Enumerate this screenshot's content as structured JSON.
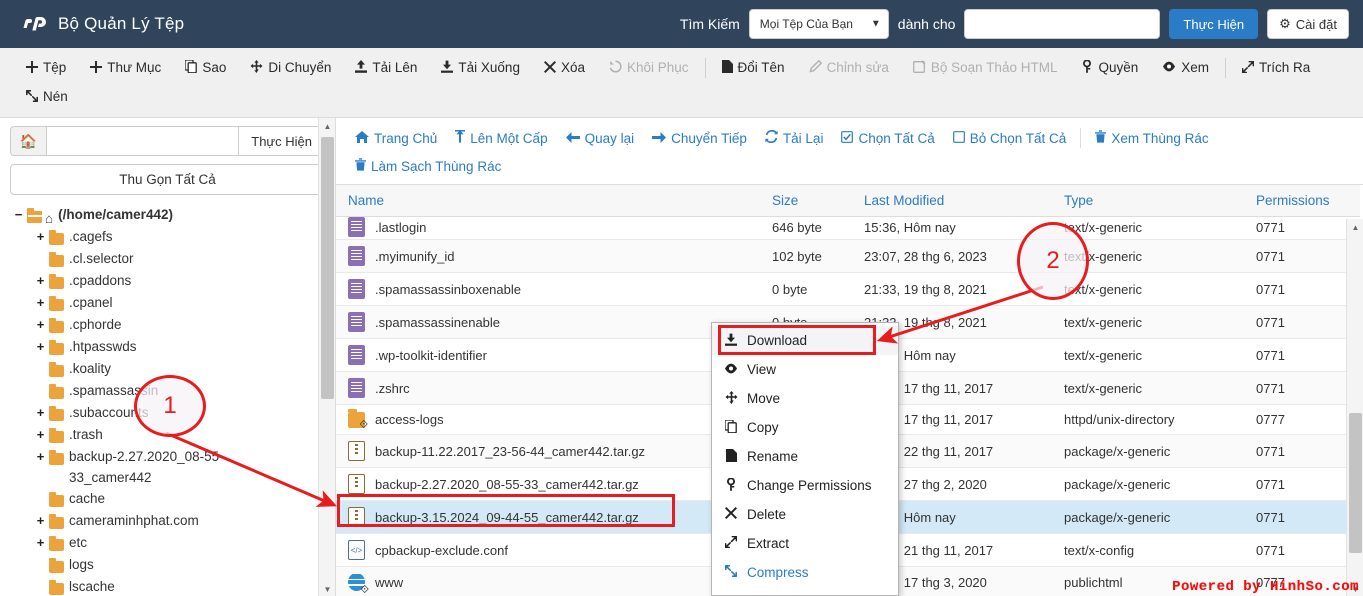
{
  "topbar": {
    "logo": "cp-logo-icon",
    "title": "Bộ Quản Lý Tệp",
    "search_label": "Tìm Kiếm",
    "search_scope_selected": "Mọi Tệp Của Bạn",
    "for_label": "dành cho",
    "search_value": "",
    "search_placeholder": "",
    "go_label": "Thực Hiện",
    "settings_label": "Cài đặt",
    "accent": "#2a7cc7",
    "background": "#30455c"
  },
  "toolbar": {
    "items": [
      {
        "label": "Tệp",
        "icon": "plus-icon",
        "disabled": false,
        "sep_after": false
      },
      {
        "label": "Thư Mục",
        "icon": "plus-icon",
        "disabled": false,
        "sep_after": false
      },
      {
        "label": "Sao",
        "icon": "copy-icon",
        "disabled": false,
        "sep_after": false
      },
      {
        "label": "Di Chuyển",
        "icon": "move-icon",
        "disabled": false,
        "sep_after": false
      },
      {
        "label": "Tải Lên",
        "icon": "upload-icon",
        "disabled": false,
        "sep_after": false
      },
      {
        "label": "Tải Xuống",
        "icon": "download-icon",
        "disabled": false,
        "sep_after": false
      },
      {
        "label": "Xóa",
        "icon": "x-icon",
        "disabled": false,
        "sep_after": false
      },
      {
        "label": "Khôi Phục",
        "icon": "restore-icon",
        "disabled": true,
        "sep_after": true
      },
      {
        "label": "Đổi Tên",
        "icon": "file-icon",
        "disabled": false,
        "sep_after": false
      },
      {
        "label": "Chỉnh sửa",
        "icon": "pencil-icon",
        "disabled": true,
        "sep_after": false
      },
      {
        "label": "Bộ Soạn Thảo HTML",
        "icon": "html-editor-icon",
        "disabled": true,
        "sep_after": false
      },
      {
        "label": "Quyền",
        "icon": "key-icon",
        "disabled": false,
        "sep_after": false
      },
      {
        "label": "Xem",
        "icon": "eye-icon",
        "disabled": false,
        "sep_after": true
      },
      {
        "label": "Trích Ra",
        "icon": "extract-icon",
        "disabled": false,
        "sep_after": false
      },
      {
        "label": "Nén",
        "icon": "compress-icon",
        "disabled": false,
        "sep_after": false
      }
    ]
  },
  "sidebar": {
    "home_icon": "home-icon",
    "path_value": "",
    "go_label": "Thực Hiện",
    "collapse_all_label": "Thu Gọn Tất Cả",
    "tree": [
      {
        "label": "(/home/camer442)",
        "toggle": "−",
        "level": 0,
        "root": true,
        "icon": "home-folder-open-icon"
      },
      {
        "label": ".cagefs",
        "toggle": "+",
        "level": 1,
        "root": false,
        "icon": "folder-icon"
      },
      {
        "label": ".cl.selector",
        "toggle": "",
        "level": 1,
        "root": false,
        "icon": "folder-icon"
      },
      {
        "label": ".cpaddons",
        "toggle": "+",
        "level": 1,
        "root": false,
        "icon": "folder-icon"
      },
      {
        "label": ".cpanel",
        "toggle": "+",
        "level": 1,
        "root": false,
        "icon": "folder-icon"
      },
      {
        "label": ".cphorde",
        "toggle": "+",
        "level": 1,
        "root": false,
        "icon": "folder-icon"
      },
      {
        "label": ".htpasswds",
        "toggle": "+",
        "level": 1,
        "root": false,
        "icon": "folder-icon"
      },
      {
        "label": ".koality",
        "toggle": "",
        "level": 1,
        "root": false,
        "icon": "folder-icon"
      },
      {
        "label": ".spamassassin",
        "toggle": "",
        "level": 1,
        "root": false,
        "icon": "folder-icon"
      },
      {
        "label": ".subaccounts",
        "toggle": "+",
        "level": 1,
        "root": false,
        "icon": "folder-icon"
      },
      {
        "label": ".trash",
        "toggle": "+",
        "level": 1,
        "root": false,
        "icon": "folder-icon"
      },
      {
        "label": "backup-2.27.2020_08-55-33_camer442",
        "toggle": "+",
        "level": 1,
        "root": false,
        "icon": "folder-icon",
        "wrapped": true
      },
      {
        "label": "cache",
        "toggle": "",
        "level": 1,
        "root": false,
        "icon": "folder-icon"
      },
      {
        "label": "cameraminhphat.com",
        "toggle": "+",
        "level": 1,
        "root": false,
        "icon": "folder-icon"
      },
      {
        "label": "etc",
        "toggle": "+",
        "level": 1,
        "root": false,
        "icon": "folder-icon"
      },
      {
        "label": "logs",
        "toggle": "",
        "level": 1,
        "root": false,
        "icon": "folder-icon"
      },
      {
        "label": "lscache",
        "toggle": "",
        "level": 1,
        "root": false,
        "icon": "folder-icon"
      }
    ]
  },
  "content_nav": {
    "items": [
      {
        "label": "Trang Chủ",
        "icon": "home-icon",
        "sep_after": false
      },
      {
        "label": "Lên Một Cấp",
        "icon": "up-icon",
        "sep_after": false
      },
      {
        "label": "Quay lại",
        "icon": "back-arrow-icon",
        "sep_after": false
      },
      {
        "label": "Chuyển Tiếp",
        "icon": "forward-arrow-icon",
        "sep_after": false
      },
      {
        "label": "Tải Lại",
        "icon": "reload-icon",
        "sep_after": false
      },
      {
        "label": "Chọn Tất Cả",
        "icon": "checkbox-checked-icon",
        "sep_after": false
      },
      {
        "label": "Bỏ Chọn Tất Cả",
        "icon": "checkbox-empty-icon",
        "sep_after": true
      },
      {
        "label": "Xem Thùng Rác",
        "icon": "trash-icon",
        "sep_after": false
      },
      {
        "label": "Làm Sạch Thùng Rác",
        "icon": "trash-icon",
        "sep_after": false
      }
    ]
  },
  "table": {
    "columns": [
      "Name",
      "Size",
      "Last Modified",
      "Type",
      "Permissions"
    ],
    "rows": [
      {
        "name": ".lastlogin",
        "size": "646 byte",
        "modified": "15:36, Hôm nay",
        "type": "text/x-generic",
        "perm": "0771",
        "icon": "text-file-icon",
        "partial": true,
        "selected": false
      },
      {
        "name": ".myimunify_id",
        "size": "102 byte",
        "modified": "23:07, 28 thg 6, 2023",
        "type": "text/x-generic",
        "perm": "0771",
        "icon": "text-file-icon",
        "partial": false,
        "selected": false
      },
      {
        "name": ".spamassassinboxenable",
        "size": "0 byte",
        "modified": "21:33, 19 thg 8, 2021",
        "type": "text/x-generic",
        "perm": "0771",
        "icon": "text-file-icon",
        "partial": false,
        "selected": false
      },
      {
        "name": ".spamassassinenable",
        "size": "0 byte",
        "modified": "21:33, 19 thg 8, 2021",
        "type": "text/x-generic",
        "perm": "0771",
        "icon": "text-file-icon",
        "partial": false,
        "selected": false
      },
      {
        "name": ".wp-toolkit-identifier",
        "size": "",
        "modified": "13:03, Hôm nay",
        "type": "text/x-generic",
        "perm": "0771",
        "icon": "text-file-icon",
        "partial": false,
        "selected": false
      },
      {
        "name": ".zshrc",
        "size": "",
        "modified": "07:57, 17 thg 11, 2017",
        "type": "text/x-generic",
        "perm": "0771",
        "icon": "text-file-icon",
        "partial": false,
        "selected": false
      },
      {
        "name": "access-logs",
        "size": "",
        "modified": "07:50, 17 thg 11, 2017",
        "type": "httpd/unix-directory",
        "perm": "0777",
        "icon": "folder-link-icon",
        "partial": false,
        "selected": false
      },
      {
        "name": "backup-11.22.2017_23-56-44_camer442.tar.gz",
        "size": "",
        "modified": "23:58, 22 thg 11, 2017",
        "type": "package/x-generic",
        "perm": "0771",
        "icon": "archive-icon",
        "partial": false,
        "selected": false
      },
      {
        "name": "backup-2.27.2020_08-55-33_camer442.tar.gz",
        "size": "",
        "modified": "08:57, 27 thg 2, 2020",
        "type": "package/x-generic",
        "perm": "0771",
        "icon": "archive-icon",
        "partial": false,
        "selected": false
      },
      {
        "name": "backup-3.15.2024_09-44-55_camer442.tar.gz",
        "size": "",
        "modified": "09:45, Hôm nay",
        "type": "package/x-generic",
        "perm": "0771",
        "icon": "archive-icon",
        "partial": false,
        "selected": true
      },
      {
        "name": "cpbackup-exclude.conf",
        "size": "",
        "modified": "08:02, 21 thg 11, 2017",
        "type": "text/x-config",
        "perm": "0771",
        "icon": "code-file-icon",
        "partial": false,
        "selected": false
      },
      {
        "name": "www",
        "size": "",
        "modified": "08:51, 17 thg 3, 2020",
        "type": "publichtml",
        "perm": "0777",
        "icon": "globe-link-icon",
        "partial": false,
        "selected": false
      }
    ]
  },
  "context_menu": {
    "items": [
      {
        "label": "Download",
        "icon": "download-icon",
        "highlighted": true,
        "link": false
      },
      {
        "label": "View",
        "icon": "eye-icon",
        "highlighted": false,
        "link": false
      },
      {
        "label": "Move",
        "icon": "move-icon",
        "highlighted": false,
        "link": false
      },
      {
        "label": "Copy",
        "icon": "copy-icon",
        "highlighted": false,
        "link": false
      },
      {
        "label": "Rename",
        "icon": "file-icon",
        "highlighted": false,
        "link": false
      },
      {
        "label": "Change Permissions",
        "icon": "key-icon",
        "highlighted": false,
        "link": false
      },
      {
        "label": "Delete",
        "icon": "x-icon",
        "highlighted": false,
        "link": false
      },
      {
        "label": "Extract",
        "icon": "extract-icon",
        "highlighted": false,
        "link": false
      },
      {
        "label": "Compress",
        "icon": "compress-icon",
        "highlighted": false,
        "link": true
      }
    ]
  },
  "annotations": {
    "marker_1": "1",
    "marker_2": "2",
    "color": "#e81c1c",
    "watermark": "Powered by HinhSo.com"
  }
}
